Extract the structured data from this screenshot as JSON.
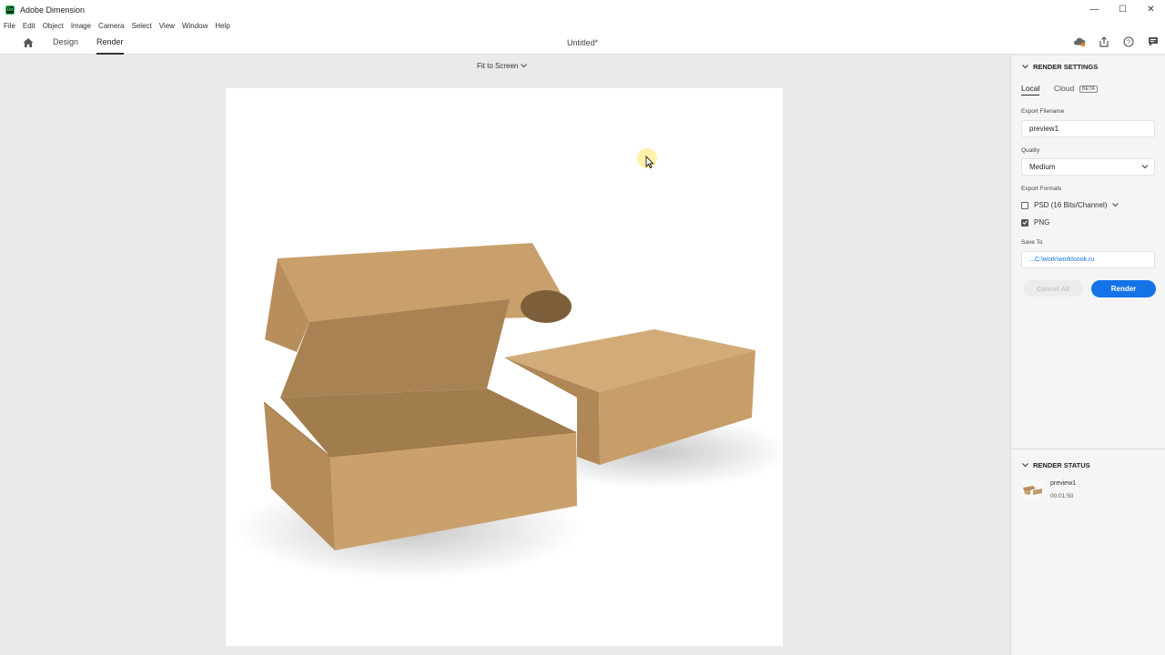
{
  "window": {
    "app_title": "Adobe Dimension",
    "minimize": "—",
    "maximize": "☐",
    "close": "✕"
  },
  "menu": [
    "File",
    "Edit",
    "Object",
    "Image",
    "Camera",
    "Select",
    "View",
    "Window",
    "Help"
  ],
  "nav": {
    "design_tab": "Design",
    "render_tab": "Render",
    "active_tab": "Render",
    "document_title": "Untitled*"
  },
  "canvas": {
    "zoom_label": "Fit to Screen"
  },
  "render_settings": {
    "section_title": "RENDER SETTINGS",
    "tab_local": "Local",
    "tab_cloud": "Cloud",
    "beta_badge": "BETA",
    "export_filename_label": "Export Filename",
    "export_filename_value": "preview1",
    "quality_label": "Quality",
    "quality_value": "Medium",
    "export_formats_label": "Export Formats",
    "formats": [
      {
        "label": "PSD (16 Bits/Channel)",
        "checked": false
      },
      {
        "label": "PNG",
        "checked": true
      }
    ],
    "save_to_label": "Save To",
    "save_to_value": "...C:\\work\\workloook.ru",
    "cancel_all_label": "Cancel All",
    "render_label": "Render"
  },
  "render_status": {
    "section_title": "RENDER STATUS",
    "item_name": "preview1",
    "item_time": "00:01:50"
  },
  "colors": {
    "accent": "#1473e6",
    "cardboard": "#c9a46e"
  }
}
